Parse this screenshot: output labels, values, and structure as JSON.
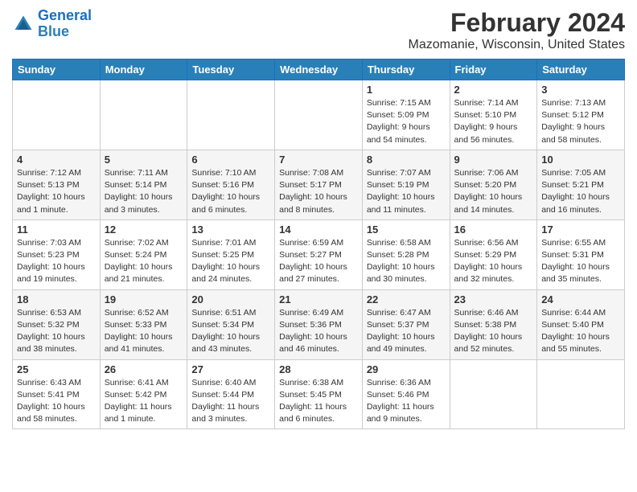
{
  "header": {
    "logo_line1": "General",
    "logo_line2": "Blue",
    "main_title": "February 2024",
    "subtitle": "Mazomanie, Wisconsin, United States"
  },
  "days_of_week": [
    "Sunday",
    "Monday",
    "Tuesday",
    "Wednesday",
    "Thursday",
    "Friday",
    "Saturday"
  ],
  "weeks": [
    [
      {
        "day": "",
        "info": ""
      },
      {
        "day": "",
        "info": ""
      },
      {
        "day": "",
        "info": ""
      },
      {
        "day": "",
        "info": ""
      },
      {
        "day": "1",
        "info": "Sunrise: 7:15 AM\nSunset: 5:09 PM\nDaylight: 9 hours\nand 54 minutes."
      },
      {
        "day": "2",
        "info": "Sunrise: 7:14 AM\nSunset: 5:10 PM\nDaylight: 9 hours\nand 56 minutes."
      },
      {
        "day": "3",
        "info": "Sunrise: 7:13 AM\nSunset: 5:12 PM\nDaylight: 9 hours\nand 58 minutes."
      }
    ],
    [
      {
        "day": "4",
        "info": "Sunrise: 7:12 AM\nSunset: 5:13 PM\nDaylight: 10 hours\nand 1 minute."
      },
      {
        "day": "5",
        "info": "Sunrise: 7:11 AM\nSunset: 5:14 PM\nDaylight: 10 hours\nand 3 minutes."
      },
      {
        "day": "6",
        "info": "Sunrise: 7:10 AM\nSunset: 5:16 PM\nDaylight: 10 hours\nand 6 minutes."
      },
      {
        "day": "7",
        "info": "Sunrise: 7:08 AM\nSunset: 5:17 PM\nDaylight: 10 hours\nand 8 minutes."
      },
      {
        "day": "8",
        "info": "Sunrise: 7:07 AM\nSunset: 5:19 PM\nDaylight: 10 hours\nand 11 minutes."
      },
      {
        "day": "9",
        "info": "Sunrise: 7:06 AM\nSunset: 5:20 PM\nDaylight: 10 hours\nand 14 minutes."
      },
      {
        "day": "10",
        "info": "Sunrise: 7:05 AM\nSunset: 5:21 PM\nDaylight: 10 hours\nand 16 minutes."
      }
    ],
    [
      {
        "day": "11",
        "info": "Sunrise: 7:03 AM\nSunset: 5:23 PM\nDaylight: 10 hours\nand 19 minutes."
      },
      {
        "day": "12",
        "info": "Sunrise: 7:02 AM\nSunset: 5:24 PM\nDaylight: 10 hours\nand 21 minutes."
      },
      {
        "day": "13",
        "info": "Sunrise: 7:01 AM\nSunset: 5:25 PM\nDaylight: 10 hours\nand 24 minutes."
      },
      {
        "day": "14",
        "info": "Sunrise: 6:59 AM\nSunset: 5:27 PM\nDaylight: 10 hours\nand 27 minutes."
      },
      {
        "day": "15",
        "info": "Sunrise: 6:58 AM\nSunset: 5:28 PM\nDaylight: 10 hours\nand 30 minutes."
      },
      {
        "day": "16",
        "info": "Sunrise: 6:56 AM\nSunset: 5:29 PM\nDaylight: 10 hours\nand 32 minutes."
      },
      {
        "day": "17",
        "info": "Sunrise: 6:55 AM\nSunset: 5:31 PM\nDaylight: 10 hours\nand 35 minutes."
      }
    ],
    [
      {
        "day": "18",
        "info": "Sunrise: 6:53 AM\nSunset: 5:32 PM\nDaylight: 10 hours\nand 38 minutes."
      },
      {
        "day": "19",
        "info": "Sunrise: 6:52 AM\nSunset: 5:33 PM\nDaylight: 10 hours\nand 41 minutes."
      },
      {
        "day": "20",
        "info": "Sunrise: 6:51 AM\nSunset: 5:34 PM\nDaylight: 10 hours\nand 43 minutes."
      },
      {
        "day": "21",
        "info": "Sunrise: 6:49 AM\nSunset: 5:36 PM\nDaylight: 10 hours\nand 46 minutes."
      },
      {
        "day": "22",
        "info": "Sunrise: 6:47 AM\nSunset: 5:37 PM\nDaylight: 10 hours\nand 49 minutes."
      },
      {
        "day": "23",
        "info": "Sunrise: 6:46 AM\nSunset: 5:38 PM\nDaylight: 10 hours\nand 52 minutes."
      },
      {
        "day": "24",
        "info": "Sunrise: 6:44 AM\nSunset: 5:40 PM\nDaylight: 10 hours\nand 55 minutes."
      }
    ],
    [
      {
        "day": "25",
        "info": "Sunrise: 6:43 AM\nSunset: 5:41 PM\nDaylight: 10 hours\nand 58 minutes."
      },
      {
        "day": "26",
        "info": "Sunrise: 6:41 AM\nSunset: 5:42 PM\nDaylight: 11 hours\nand 1 minute."
      },
      {
        "day": "27",
        "info": "Sunrise: 6:40 AM\nSunset: 5:44 PM\nDaylight: 11 hours\nand 3 minutes."
      },
      {
        "day": "28",
        "info": "Sunrise: 6:38 AM\nSunset: 5:45 PM\nDaylight: 11 hours\nand 6 minutes."
      },
      {
        "day": "29",
        "info": "Sunrise: 6:36 AM\nSunset: 5:46 PM\nDaylight: 11 hours\nand 9 minutes."
      },
      {
        "day": "",
        "info": ""
      },
      {
        "day": "",
        "info": ""
      }
    ]
  ]
}
